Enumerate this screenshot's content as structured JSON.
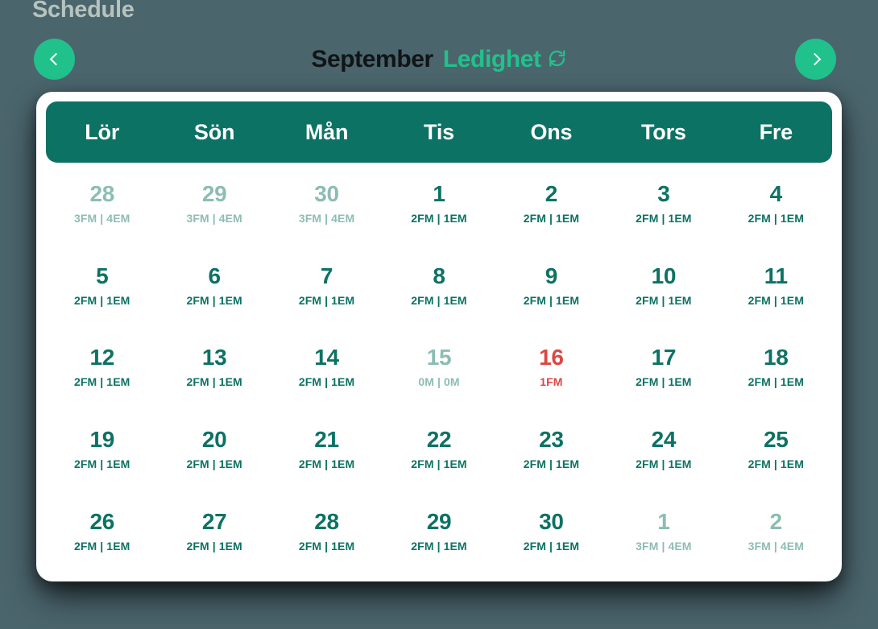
{
  "page": {
    "title": "Schedule",
    "background_color": "#4b656d",
    "title_color": "#b6c3be"
  },
  "toolbar": {
    "prev_label": "‹",
    "next_label": "›",
    "prev_icon": "chevron-left-icon",
    "next_icon": "chevron-right-icon",
    "nav_button_color": "#21c18c",
    "month_name": "September",
    "status_label": "Ledighet",
    "status_icon": "refresh-circle-icon",
    "status_color": "#21c18c",
    "month_name_color": "#111416"
  },
  "calendar": {
    "header_background": "#0c7264",
    "card_background": "#ffffff",
    "current_color": "#0c7264",
    "muted_color": "#8cbdb4",
    "alert_color": "#dc4843",
    "weekdays": [
      "Lör",
      "Sön",
      "Mån",
      "Tis",
      "Ons",
      "Tors",
      "Fre"
    ],
    "days": [
      {
        "number": "28",
        "slots": "3FM | 4EM",
        "state": "muted"
      },
      {
        "number": "29",
        "slots": "3FM | 4EM",
        "state": "muted"
      },
      {
        "number": "30",
        "slots": "3FM | 4EM",
        "state": "muted"
      },
      {
        "number": "1",
        "slots": "2FM | 1EM",
        "state": "current"
      },
      {
        "number": "2",
        "slots": "2FM | 1EM",
        "state": "current"
      },
      {
        "number": "3",
        "slots": "2FM | 1EM",
        "state": "current"
      },
      {
        "number": "4",
        "slots": "2FM | 1EM",
        "state": "current"
      },
      {
        "number": "5",
        "slots": "2FM | 1EM",
        "state": "current"
      },
      {
        "number": "6",
        "slots": "2FM | 1EM",
        "state": "current"
      },
      {
        "number": "7",
        "slots": "2FM | 1EM",
        "state": "current"
      },
      {
        "number": "8",
        "slots": "2FM | 1EM",
        "state": "current"
      },
      {
        "number": "9",
        "slots": "2FM | 1EM",
        "state": "current"
      },
      {
        "number": "10",
        "slots": "2FM | 1EM",
        "state": "current"
      },
      {
        "number": "11",
        "slots": "2FM | 1EM",
        "state": "current"
      },
      {
        "number": "12",
        "slots": "2FM | 1EM",
        "state": "current"
      },
      {
        "number": "13",
        "slots": "2FM | 1EM",
        "state": "current"
      },
      {
        "number": "14",
        "slots": "2FM | 1EM",
        "state": "current"
      },
      {
        "number": "15",
        "slots": "0M | 0M",
        "state": "muted"
      },
      {
        "number": "16",
        "slots": "1FM",
        "state": "alert"
      },
      {
        "number": "17",
        "slots": "2FM | 1EM",
        "state": "current"
      },
      {
        "number": "18",
        "slots": "2FM | 1EM",
        "state": "current"
      },
      {
        "number": "19",
        "slots": "2FM | 1EM",
        "state": "current"
      },
      {
        "number": "20",
        "slots": "2FM | 1EM",
        "state": "current"
      },
      {
        "number": "21",
        "slots": "2FM | 1EM",
        "state": "current"
      },
      {
        "number": "22",
        "slots": "2FM | 1EM",
        "state": "current"
      },
      {
        "number": "23",
        "slots": "2FM | 1EM",
        "state": "current"
      },
      {
        "number": "24",
        "slots": "2FM | 1EM",
        "state": "current"
      },
      {
        "number": "25",
        "slots": "2FM | 1EM",
        "state": "current"
      },
      {
        "number": "26",
        "slots": "2FM | 1EM",
        "state": "current"
      },
      {
        "number": "27",
        "slots": "2FM | 1EM",
        "state": "current"
      },
      {
        "number": "28",
        "slots": "2FM | 1EM",
        "state": "current"
      },
      {
        "number": "29",
        "slots": "2FM | 1EM",
        "state": "current"
      },
      {
        "number": "30",
        "slots": "2FM | 1EM",
        "state": "current"
      },
      {
        "number": "1",
        "slots": "3FM | 4EM",
        "state": "muted"
      },
      {
        "number": "2",
        "slots": "3FM | 4EM",
        "state": "muted"
      }
    ]
  }
}
